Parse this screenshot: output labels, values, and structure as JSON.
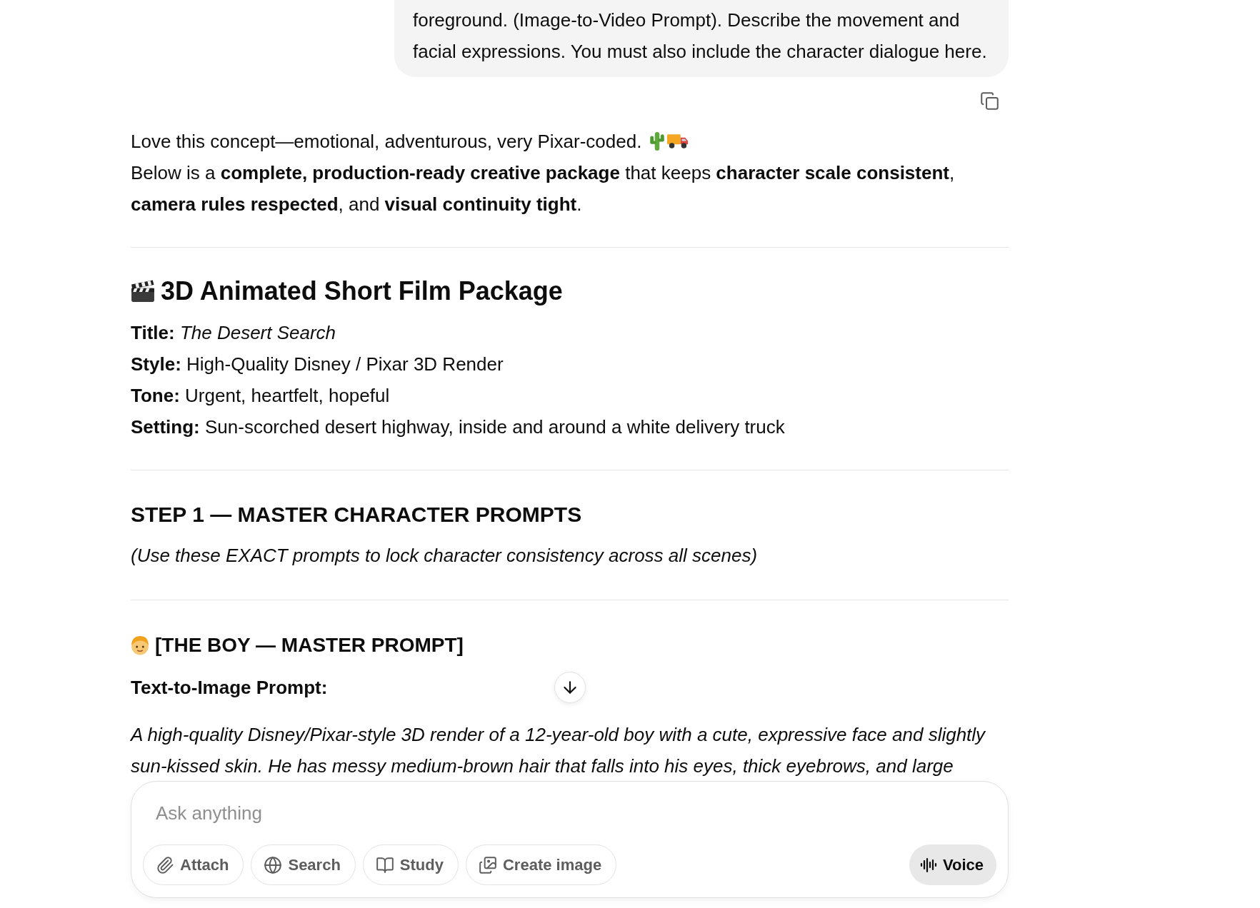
{
  "user_message": {
    "text": "foreground. (Image-to-Video Prompt). Describe the movement and facial expressions. You must also include the character dialogue here."
  },
  "assistant_message": {
    "intro": [
      "Love this concept—emotional, adventurous, very Pixar-coded.",
      "Below is a **complete, production-ready creative package** that keeps **character scale consistent**, **camera rules respected**, and **visual continuity tight**."
    ],
    "package_heading": "3D Animated Short Film Package",
    "details": [
      "**Title:** *The Desert Search*",
      "**Style:** High-Quality Disney / Pixar 3D Render",
      "**Tone:** Urgent, heartfelt, hopeful",
      "**Setting:** Sun-scorched desert highway, inside and around a white delivery truck"
    ],
    "step_heading": "STEP 1 — MASTER CHARACTER PROMPTS",
    "step_note": "(Use these EXACT prompts to lock character consistency across all scenes)",
    "character_heading": "[THE BOY — MASTER PROMPT]",
    "prompt_label": "Text-to-Image Prompt:",
    "prompt_text": "A high-quality Disney/Pixar-style 3D render of a 12-year-old boy with a cute, expressive face and slightly sun-kissed skin. He has messy medium-brown hair that falls into his eyes, thick eyebrows, and large"
  },
  "composer": {
    "placeholder": "Ask anything",
    "tools": [
      {
        "kind": "attach",
        "label": "Attach"
      },
      {
        "kind": "search",
        "label": "Search"
      },
      {
        "kind": "study",
        "label": "Study"
      },
      {
        "kind": "image",
        "label": "Create image"
      }
    ],
    "voice_label": "Voice"
  }
}
